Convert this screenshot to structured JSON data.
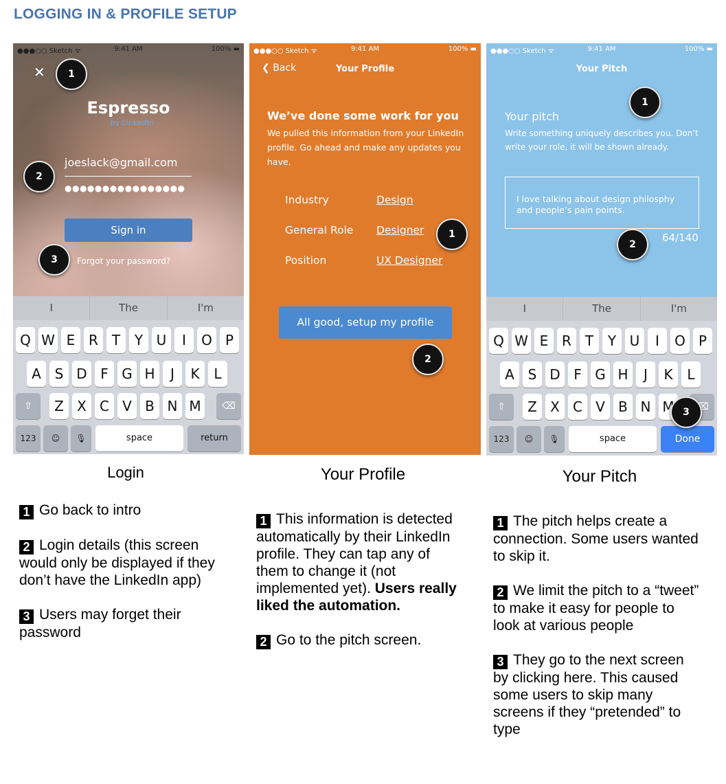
{
  "heading": "LOGGING IN & PROFILE SETUP",
  "colors": {
    "heading": "#4a74ad",
    "profile_bg": "#e07b2c",
    "pitch_bg": "#8cc3e9",
    "button_blue": "#4a8ad0",
    "done_blue": "#3b82f6"
  },
  "status": {
    "carrier": "●●●○○ Sketch ᯤ",
    "time": "9:41 AM",
    "battery": "100% ▬"
  },
  "login": {
    "close_icon": "close-icon",
    "brand": "Espresso",
    "brand_sub": "by LinkedIn",
    "email": "joeslack@gmail.com",
    "password": "●●●●●●●●●●●●●●●●",
    "signin": "Sign in",
    "forgot": "Forgot your password?",
    "suggestions": [
      "I",
      "The",
      "I'm"
    ],
    "keys": {
      "row1": [
        "Q",
        "W",
        "E",
        "R",
        "T",
        "Y",
        "U",
        "I",
        "O",
        "P"
      ],
      "row2": [
        "A",
        "S",
        "D",
        "F",
        "G",
        "H",
        "J",
        "K",
        "L"
      ],
      "row3": [
        "Z",
        "X",
        "C",
        "V",
        "B",
        "N",
        "M"
      ],
      "num": "123",
      "space": "space",
      "return": "return"
    },
    "caption": "Login"
  },
  "profile": {
    "back": "Back",
    "title": "Your Profile",
    "headline": "We’ve done some work for you",
    "desc": "We pulled this information from your LinkedIn profile. Go ahead and make any updates you have.",
    "fields": [
      {
        "label": "Industry",
        "value": "Design"
      },
      {
        "label": "General Role",
        "value": "Designer"
      },
      {
        "label": "Position",
        "value": "UX Designer"
      }
    ],
    "button": "All good, setup my profile",
    "caption": "Your Profile"
  },
  "pitch": {
    "title": "Your Pitch",
    "headline": "Your pitch",
    "desc": "Write something uniquely describes you. Don’t write your role, it will be shown already.",
    "text": "I love talking about design philosphy and people’s pain points.",
    "counter": "64/140",
    "suggestions": [
      "I",
      "The",
      "I'm"
    ],
    "keys": {
      "num": "123",
      "space": "space",
      "done": "Done"
    },
    "caption": "Your Pitch"
  },
  "markers": {
    "one": "1",
    "two": "2",
    "three": "3"
  },
  "notes": {
    "login": [
      {
        "num": "1",
        "text": "Go back to intro"
      },
      {
        "num": "2",
        "text": "Login details (this screen would only be displayed if they don’t have the LinkedIn app)"
      },
      {
        "num": "3",
        "text": "Users may forget their password"
      }
    ],
    "profile": [
      {
        "num": "1",
        "text": "This information is detected automatically by their LinkedIn profile. They can tap any of them to change it (not implemented yet).",
        "bold": "Users really liked the automation."
      },
      {
        "num": "2",
        "text": "Go to the pitch screen."
      }
    ],
    "pitch": [
      {
        "num": "1",
        "text": "The pitch helps create a connection. Some users wanted to skip it."
      },
      {
        "num": "2",
        "text": "We limit the pitch to a “tweet” to make it easy for people to look at various people"
      },
      {
        "num": "3",
        "text": "They go to the next screen by clicking here. This caused some users to skip many screens if they “pretended” to type"
      }
    ]
  }
}
